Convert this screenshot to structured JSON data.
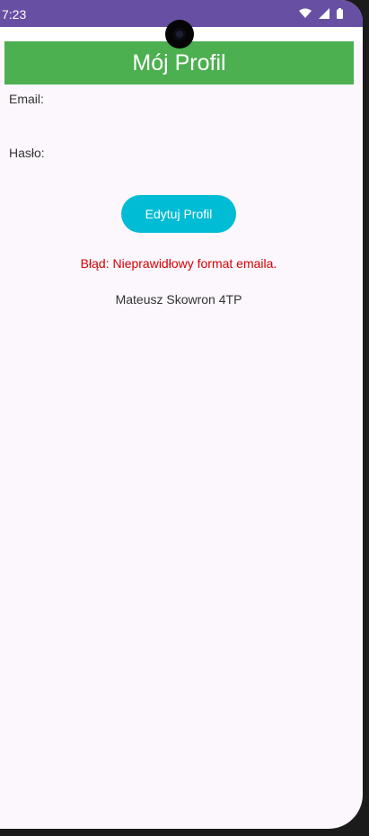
{
  "status_bar": {
    "time": "7:23",
    "icons": [
      "wifi-icon",
      "signal-icon",
      "battery-icon"
    ]
  },
  "header": {
    "title": "Mój Profil"
  },
  "form": {
    "email_label": "Email:",
    "password_label": "Hasło:",
    "edit_button_label": "Edytuj Profil"
  },
  "messages": {
    "error": "Błąd: Nieprawidłowy format emaila."
  },
  "footer": {
    "author": "Mateusz Skowron 4TP"
  },
  "colors": {
    "status_bar": "#6750a4",
    "header": "#4caf50",
    "button": "#00bcd4",
    "error": "#d50000",
    "background": "#fcf6fd"
  }
}
